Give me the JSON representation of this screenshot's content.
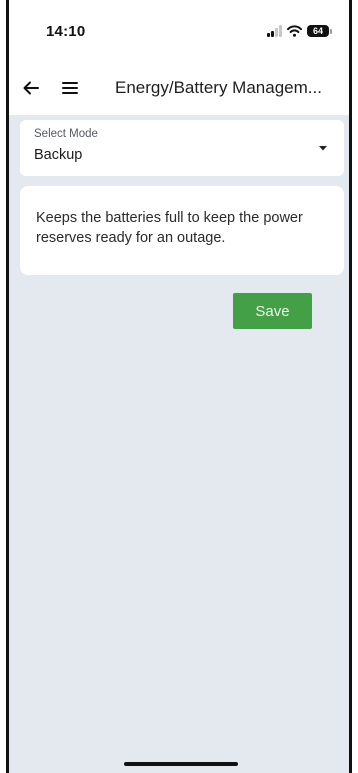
{
  "status_bar": {
    "time": "14:10",
    "battery_level": "64",
    "signal_icon": "cellular-signal-icon",
    "wifi_icon": "wifi-icon",
    "battery_icon": "battery-icon"
  },
  "app_bar": {
    "title": "Energy/Battery Managem...",
    "back_icon": "arrow-back-icon",
    "menu_icon": "hamburger-menu-icon"
  },
  "mode_select": {
    "label": "Select Mode",
    "value": "Backup",
    "icon": "dropdown-arrow-icon"
  },
  "description": {
    "text": "Keeps the batteries full to keep the power reserves ready for an outage."
  },
  "actions": {
    "save_label": "Save"
  },
  "colors": {
    "background": "#e4e8ef",
    "card": "#ffffff",
    "save_button": "#43a047",
    "text": "#1f1f1f"
  }
}
